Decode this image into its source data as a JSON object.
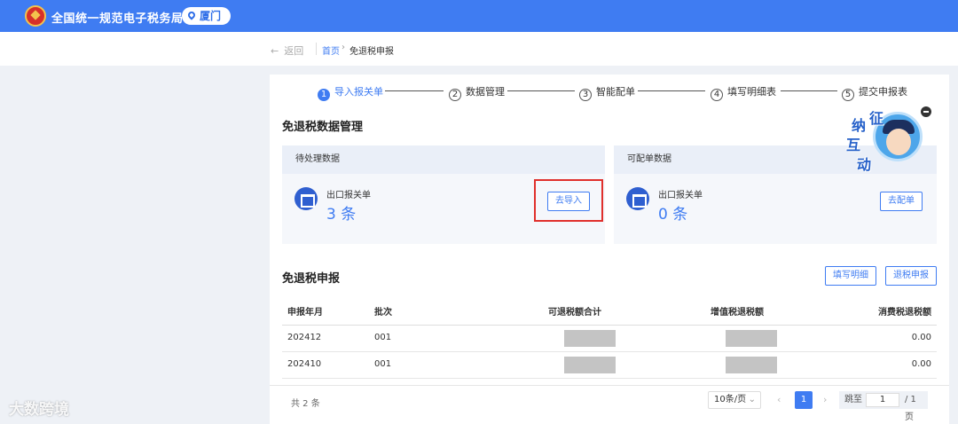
{
  "header": {
    "title": "全国统一规范电子税务局",
    "region": "厦门",
    "brand_color": "#3f7cf2"
  },
  "breadcrumb": {
    "back": "返回",
    "home": "首页",
    "separator": "›",
    "current": "免退税申报"
  },
  "steps": [
    {
      "num": "1",
      "label": "导入报关单",
      "active": true
    },
    {
      "num": "2",
      "label": "数据管理",
      "active": false
    },
    {
      "num": "3",
      "label": "智能配单",
      "active": false
    },
    {
      "num": "4",
      "label": "填写明细表",
      "active": false
    },
    {
      "num": "5",
      "label": "提交申报表",
      "active": false
    }
  ],
  "data_mgmt": {
    "title": "免退税数据管理",
    "pending": {
      "header": "待处理数据",
      "label": "出口报关单",
      "count": "3 条",
      "button": "去导入"
    },
    "matchable": {
      "header": "可配单数据",
      "label": "出口报关单",
      "count": "0 条",
      "button": "去配单"
    }
  },
  "assistant": {
    "text": [
      "征",
      "纳",
      "互",
      "动"
    ]
  },
  "declaration": {
    "title": "免退税申报",
    "fill_button": "填写明细",
    "withdraw_button": "退税申报",
    "columns": [
      "申报年月",
      "批次",
      "可退税额合计",
      "增值税退税额",
      "消费税退税额"
    ],
    "rows": [
      {
        "period": "202412",
        "batch": "001",
        "consumption_tax": "0.00"
      },
      {
        "period": "202410",
        "batch": "001",
        "consumption_tax": "0.00"
      }
    ]
  },
  "pagination": {
    "total": "共 2 条",
    "page_size": "10条/页",
    "prev": "‹",
    "next": "›",
    "current": "1",
    "goto_label": "跳至",
    "goto_value": "1",
    "goto_suffix": "/ 1 页"
  },
  "watermark": "大数跨境"
}
